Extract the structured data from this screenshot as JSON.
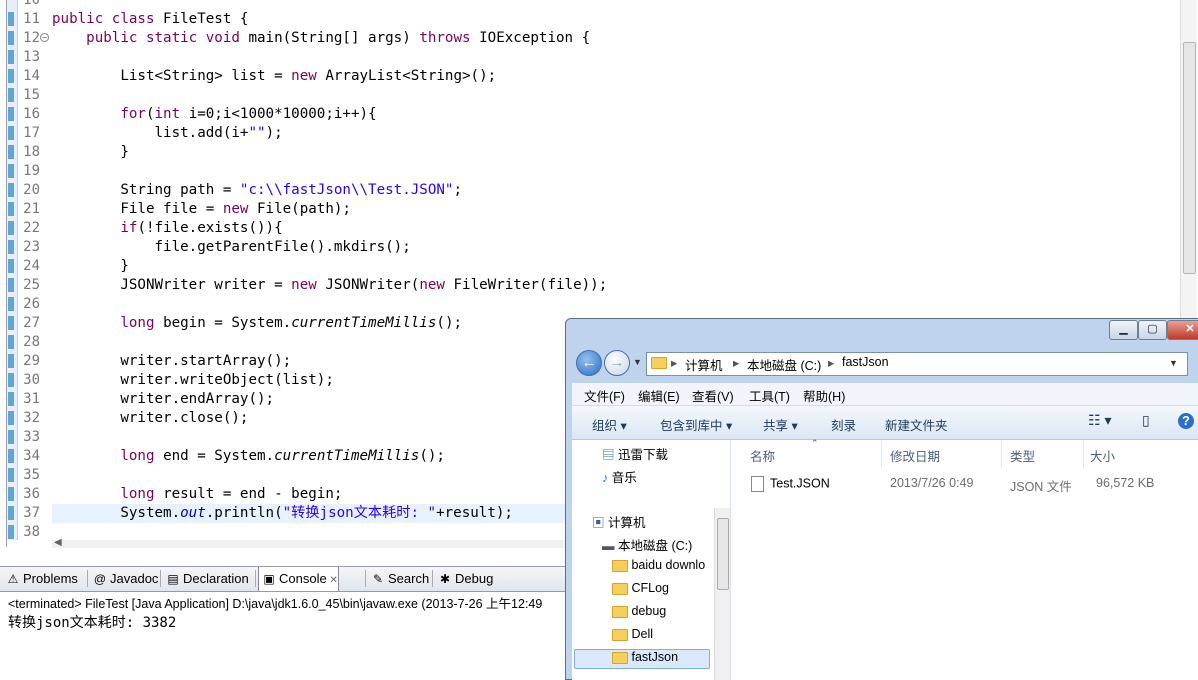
{
  "editor": {
    "lines": [
      {
        "num": "10",
        "segs": []
      },
      {
        "num": "11",
        "segs": [
          [
            "kw",
            "public class "
          ],
          [
            "",
            "FileTest {"
          ]
        ]
      },
      {
        "num": "12",
        "fold": true,
        "segs": [
          [
            "",
            "    "
          ],
          [
            "kw",
            "public static void "
          ],
          [
            "",
            "main(String[] args) "
          ],
          [
            "kw",
            "throws "
          ],
          [
            "",
            "IOException {"
          ]
        ]
      },
      {
        "num": "13",
        "segs": []
      },
      {
        "num": "14",
        "segs": [
          [
            "",
            "        List<String> list = "
          ],
          [
            "kw",
            "new "
          ],
          [
            "",
            "ArrayList<String>();"
          ]
        ]
      },
      {
        "num": "15",
        "segs": []
      },
      {
        "num": "16",
        "segs": [
          [
            "",
            "        "
          ],
          [
            "kw",
            "for"
          ],
          [
            "",
            "("
          ],
          [
            "kw",
            "int "
          ],
          [
            "",
            "i=0;i<1000*10000;i++){"
          ]
        ]
      },
      {
        "num": "17",
        "segs": [
          [
            "",
            "            list.add(i+"
          ],
          [
            "str",
            "\"\""
          ],
          [
            "",
            "); "
          ]
        ]
      },
      {
        "num": "18",
        "segs": [
          [
            "",
            "        }"
          ]
        ]
      },
      {
        "num": "19",
        "segs": []
      },
      {
        "num": "20",
        "segs": [
          [
            "",
            "        String path = "
          ],
          [
            "str",
            "\"c:\\\\fastJson\\\\Test.JSON\""
          ],
          [
            "",
            ";"
          ]
        ]
      },
      {
        "num": "21",
        "segs": [
          [
            "",
            "        File file = "
          ],
          [
            "kw",
            "new "
          ],
          [
            "",
            "File(path);"
          ]
        ]
      },
      {
        "num": "22",
        "segs": [
          [
            "",
            "        "
          ],
          [
            "kw",
            "if"
          ],
          [
            "",
            "(!file.exists()){"
          ]
        ]
      },
      {
        "num": "23",
        "segs": [
          [
            "",
            "            file.getParentFile().mkdirs();"
          ]
        ]
      },
      {
        "num": "24",
        "segs": [
          [
            "",
            "        }"
          ]
        ]
      },
      {
        "num": "25",
        "segs": [
          [
            "",
            "        JSONWriter writer = "
          ],
          [
            "kw",
            "new "
          ],
          [
            "",
            "JSONWriter("
          ],
          [
            "kw",
            "new "
          ],
          [
            "",
            "FileWriter(file));"
          ]
        ]
      },
      {
        "num": "26",
        "segs": []
      },
      {
        "num": "27",
        "segs": [
          [
            "",
            "        "
          ],
          [
            "kw",
            "long "
          ],
          [
            "",
            "begin = System."
          ],
          [
            "ital",
            "currentTimeMillis"
          ],
          [
            "",
            "();"
          ]
        ]
      },
      {
        "num": "28",
        "segs": []
      },
      {
        "num": "29",
        "segs": [
          [
            "",
            "        writer.startArray();"
          ]
        ]
      },
      {
        "num": "30",
        "segs": [
          [
            "",
            "        writer.writeObject(list);"
          ]
        ]
      },
      {
        "num": "31",
        "segs": [
          [
            "",
            "        writer.endArray();"
          ]
        ]
      },
      {
        "num": "32",
        "segs": [
          [
            "",
            "        writer.close();"
          ]
        ]
      },
      {
        "num": "33",
        "segs": []
      },
      {
        "num": "34",
        "segs": [
          [
            "",
            "        "
          ],
          [
            "kw",
            "long "
          ],
          [
            "",
            "end = System."
          ],
          [
            "ital",
            "currentTimeMillis"
          ],
          [
            "",
            "();"
          ]
        ]
      },
      {
        "num": "35",
        "segs": []
      },
      {
        "num": "36",
        "segs": [
          [
            "",
            "        "
          ],
          [
            "kw",
            "long "
          ],
          [
            "",
            "result = end - begin;"
          ]
        ]
      },
      {
        "num": "37",
        "current": true,
        "segs": [
          [
            "",
            "        System."
          ],
          [
            "fld",
            "out"
          ],
          [
            "",
            ".println("
          ],
          [
            "str",
            "\"转换json文本耗时: \""
          ],
          [
            "",
            "+result);"
          ]
        ]
      },
      {
        "num": "38",
        "segs": []
      }
    ]
  },
  "views": {
    "tabs": [
      {
        "label": "Problems",
        "icon": "⚠",
        "name": "tab-problems"
      },
      {
        "label": "Javadoc",
        "icon": "@",
        "name": "tab-javadoc"
      },
      {
        "label": "Declaration",
        "icon": "▤",
        "name": "tab-declaration"
      },
      {
        "label": "Console",
        "icon": "▣",
        "name": "tab-console",
        "active": true
      },
      {
        "label": "Search",
        "icon": "✎",
        "name": "tab-search"
      },
      {
        "label": "Debug",
        "icon": "✱",
        "name": "tab-debug"
      }
    ],
    "close_glyph": "✕",
    "terminated": "<terminated> FileTest [Java Application] D:\\java\\jdk1.6.0_45\\bin\\javaw.exe (2013-7-26 上午12:49",
    "output": "转换json文本耗时: 3382"
  },
  "explorer": {
    "caption": {
      "minimize": "▁",
      "maximize": "▢",
      "close": "✕"
    },
    "address": [
      "计算机",
      "本地磁盘 (C:)",
      "fastJson"
    ],
    "menus": [
      "文件(F)",
      "编辑(E)",
      "查看(V)",
      "工具(T)",
      "帮助(H)"
    ],
    "commands": [
      "组织 ▾",
      "包含到库中 ▾",
      "共享 ▾",
      "刻录",
      "新建文件夹"
    ],
    "help_glyph": "?",
    "nav": {
      "favorites": [
        {
          "label": "迅雷下载"
        },
        {
          "label": "音乐"
        }
      ],
      "computer": "计算机",
      "drive": "本地磁盘 (C:)",
      "folders": [
        "baidu downlo",
        "CFLog",
        "debug",
        "Dell",
        "fastJson"
      ]
    },
    "columns": [
      "名称",
      "修改日期",
      "类型",
      "大小"
    ],
    "files": [
      {
        "name": "Test.JSON",
        "date": "2013/7/26 0:49",
        "type": "JSON 文件",
        "size": "96,572 KB"
      }
    ]
  },
  "colors": {
    "keyword": "#7f0055",
    "string": "#2a00ff",
    "field": "#0000c0",
    "linenum": "#787878"
  }
}
